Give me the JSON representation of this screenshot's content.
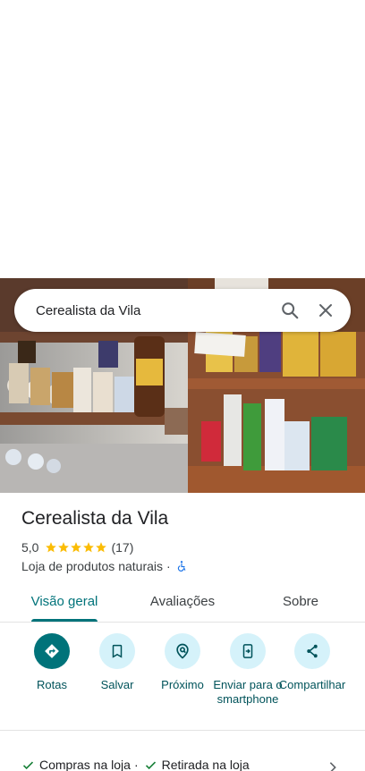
{
  "search": {
    "query": "Cerealista da Vila",
    "search_icon": "search-icon",
    "close_icon": "close-icon"
  },
  "place": {
    "name": "Cerealista da Vila",
    "rating": "5,0",
    "stars": 5,
    "review_count": "(17)",
    "category": "Loja de produtos naturais",
    "category_separator": "·",
    "accessibility_icon": "wheelchair-icon"
  },
  "tabs": [
    {
      "label": "Visão geral",
      "active": true
    },
    {
      "label": "Avaliações",
      "active": false
    },
    {
      "label": "Sobre",
      "active": false
    }
  ],
  "actions": [
    {
      "label": "Rotas",
      "icon": "directions-icon"
    },
    {
      "label": "Salvar",
      "icon": "bookmark-icon"
    },
    {
      "label": "Próximo",
      "icon": "nearby-icon"
    },
    {
      "label": "Enviar para o smartphone",
      "icon": "send-to-phone-icon"
    },
    {
      "label": "Compartilhar",
      "icon": "share-icon"
    }
  ],
  "services": [
    {
      "label": "Compras na loja",
      "icon": "check-icon"
    },
    {
      "label": "Retirada na loja",
      "icon": "check-icon"
    }
  ],
  "services_separator": "·",
  "colors": {
    "accent": "#00737a",
    "action_bg": "#d5f2fa",
    "star": "#fbbc04",
    "check": "#188038"
  }
}
